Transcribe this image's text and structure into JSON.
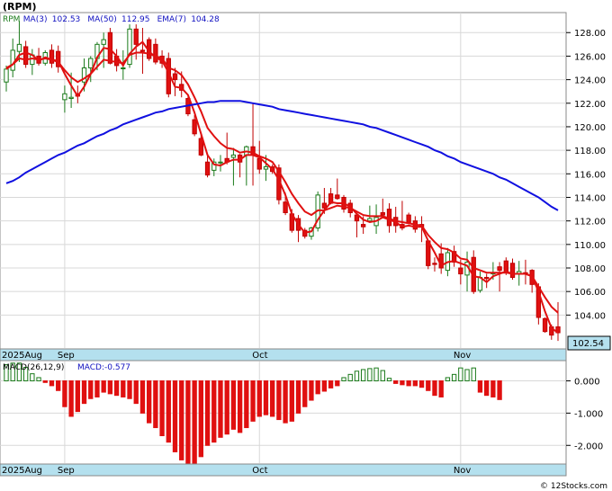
{
  "chart_data": [
    {
      "type": "candlestick",
      "title": "(RPM)",
      "legend": [
        {
          "label": "RPM",
          "color": "#000000"
        },
        {
          "label": "MA(3)",
          "value": "102.53",
          "color": "#e01010"
        },
        {
          "label": "MA(50)",
          "value": "112.95",
          "color": "#1010e0"
        },
        {
          "label": "EMA(7)",
          "value": "104.28",
          "color": "#e01010"
        }
      ],
      "ylim": [
        101.2,
        129.7
      ],
      "yticks": [
        104,
        106,
        108,
        110,
        112,
        114,
        116,
        118,
        120,
        122,
        124,
        126,
        128
      ],
      "ytick_labels": [
        "104.00",
        "106.00",
        "108.00",
        "110.00",
        "112.00",
        "114.00",
        "116.00",
        "118.00",
        "120.00",
        "122.00",
        "124.00",
        "126.00",
        "128.00"
      ],
      "last_price": "102.54",
      "x_labels": [
        {
          "label": "2025Aug",
          "index": 0
        },
        {
          "label": "Sep",
          "index": 9
        },
        {
          "label": "Oct",
          "index": 39
        },
        {
          "label": "Nov",
          "index": 70
        }
      ],
      "candles": [
        [
          123.8,
          125.2,
          123.0,
          124.9
        ],
        [
          124.8,
          127.5,
          124.2,
          126.5
        ],
        [
          126.4,
          129.0,
          125.5,
          127.0
        ],
        [
          126.8,
          127.3,
          125.0,
          125.3
        ],
        [
          125.3,
          126.6,
          124.4,
          126.1
        ],
        [
          126.0,
          126.7,
          125.2,
          125.4
        ],
        [
          125.4,
          126.5,
          125.2,
          126.3
        ],
        [
          126.5,
          127.0,
          125.0,
          125.4
        ],
        [
          126.4,
          126.9,
          124.6,
          125.1
        ],
        [
          122.3,
          123.5,
          121.2,
          122.8
        ],
        [
          122.4,
          124.6,
          121.6,
          122.5
        ],
        [
          122.8,
          123.5,
          122.0,
          122.6
        ],
        [
          123.8,
          125.8,
          123.0,
          125.0
        ],
        [
          125.0,
          126.0,
          123.8,
          125.8
        ],
        [
          125.8,
          127.2,
          124.8,
          127.0
        ],
        [
          127.0,
          128.0,
          125.0,
          127.4
        ],
        [
          128.0,
          128.4,
          125.3,
          125.4
        ],
        [
          126.0,
          126.6,
          124.7,
          125.2
        ],
        [
          125.0,
          126.5,
          124.0,
          125.0
        ],
        [
          125.3,
          128.7,
          125.0,
          128.3
        ],
        [
          128.3,
          128.7,
          125.7,
          127.0
        ],
        [
          126.5,
          128.4,
          124.5,
          126.4
        ],
        [
          127.4,
          127.6,
          125.6,
          125.8
        ],
        [
          127.0,
          127.5,
          125.3,
          125.5
        ],
        [
          126.0,
          126.5,
          125.0,
          125.4
        ],
        [
          125.8,
          126.3,
          122.5,
          122.8
        ],
        [
          124.5,
          125.0,
          122.6,
          124.0
        ],
        [
          123.6,
          124.7,
          122.5,
          123.1
        ],
        [
          122.4,
          122.6,
          120.9,
          121.1
        ],
        [
          120.6,
          121.0,
          119.2,
          119.4
        ],
        [
          119.0,
          119.3,
          117.5,
          117.6
        ],
        [
          117.0,
          117.6,
          115.7,
          115.9
        ],
        [
          116.3,
          117.3,
          115.8,
          117.0
        ],
        [
          117.0,
          117.6,
          116.2,
          117.0
        ],
        [
          117.3,
          119.5,
          116.8,
          117.0
        ],
        [
          117.4,
          118.2,
          115.0,
          117.6
        ],
        [
          117.6,
          117.7,
          115.7,
          117.0
        ],
        [
          117.6,
          118.4,
          115.0,
          118.3
        ],
        [
          118.3,
          122.0,
          115.0,
          117.6
        ],
        [
          117.3,
          118.8,
          116.0,
          116.4
        ],
        [
          116.4,
          117.6,
          115.4,
          116.6
        ],
        [
          116.6,
          116.8,
          116.0,
          116.2
        ],
        [
          116.5,
          116.8,
          113.4,
          113.8
        ],
        [
          113.6,
          114.4,
          112.5,
          112.7
        ],
        [
          112.6,
          113.0,
          111.0,
          111.2
        ],
        [
          112.2,
          112.5,
          110.2,
          111.2
        ],
        [
          111.2,
          111.4,
          110.5,
          110.7
        ],
        [
          110.7,
          111.5,
          110.4,
          111.4
        ],
        [
          111.4,
          114.5,
          111.1,
          114.2
        ],
        [
          113.5,
          114.8,
          112.6,
          113.1
        ],
        [
          114.3,
          114.8,
          113.4,
          113.5
        ],
        [
          114.2,
          115.6,
          113.8,
          113.9
        ],
        [
          114.0,
          114.2,
          112.7,
          113.0
        ],
        [
          113.5,
          113.8,
          112.3,
          112.7
        ],
        [
          112.5,
          112.6,
          110.6,
          112.0
        ],
        [
          111.7,
          112.4,
          110.9,
          111.5
        ],
        [
          112.0,
          113.3,
          111.9,
          112.2
        ],
        [
          111.6,
          113.4,
          110.9,
          112.3
        ],
        [
          112.7,
          113.9,
          112.3,
          112.5
        ],
        [
          113.0,
          113.5,
          111.0,
          111.6
        ],
        [
          112.3,
          113.2,
          111.0,
          111.6
        ],
        [
          111.7,
          113.7,
          111.2,
          111.4
        ],
        [
          112.5,
          112.7,
          111.7,
          111.8
        ],
        [
          112.0,
          112.4,
          111.0,
          111.3
        ],
        [
          111.7,
          112.4,
          110.2,
          111.5
        ],
        [
          110.3,
          110.3,
          107.9,
          108.2
        ],
        [
          108.4,
          108.9,
          107.7,
          108.3
        ],
        [
          109.2,
          110.1,
          107.5,
          108.0
        ],
        [
          107.8,
          109.7,
          107.3,
          109.3
        ],
        [
          109.4,
          109.9,
          108.1,
          108.5
        ],
        [
          108.0,
          108.7,
          106.6,
          107.5
        ],
        [
          107.4,
          109.4,
          106.0,
          108.5
        ],
        [
          108.9,
          109.5,
          105.8,
          106.0
        ],
        [
          106.1,
          107.7,
          105.9,
          107.2
        ],
        [
          107.2,
          107.5,
          106.3,
          107.1
        ],
        [
          107.5,
          108.5,
          107.0,
          107.6
        ],
        [
          108.1,
          108.5,
          106.0,
          107.8
        ],
        [
          108.6,
          108.9,
          107.4,
          107.6
        ],
        [
          108.4,
          108.8,
          107.0,
          107.2
        ],
        [
          107.5,
          108.6,
          106.5,
          107.7
        ],
        [
          107.6,
          108.7,
          106.6,
          107.5
        ],
        [
          107.8,
          107.9,
          105.9,
          106.6
        ],
        [
          106.4,
          106.7,
          103.2,
          103.8
        ],
        [
          103.7,
          103.8,
          102.5,
          102.6
        ],
        [
          103.0,
          103.2,
          101.9,
          102.3
        ],
        [
          103.0,
          105.1,
          101.8,
          102.5
        ]
      ],
      "series": [
        {
          "name": "MA(3)",
          "color": "#e01010",
          "values": [
            125.0,
            125.3,
            126.1,
            126.3,
            126.1,
            125.6,
            125.9,
            125.7,
            125.6,
            124.5,
            123.5,
            122.6,
            123.4,
            124.5,
            125.9,
            126.7,
            126.6,
            126.0,
            125.2,
            126.2,
            126.8,
            127.2,
            126.4,
            125.9,
            125.6,
            124.6,
            123.4,
            123.3,
            122.7,
            121.2,
            119.4,
            117.6,
            116.8,
            116.7,
            117.0,
            117.2,
            117.2,
            117.6,
            117.6,
            117.4,
            116.9,
            116.4,
            115.5,
            114.2,
            112.6,
            111.7,
            111.0,
            111.1,
            112.1,
            112.9,
            113.6,
            113.5,
            113.5,
            113.2,
            112.6,
            112.1,
            111.9,
            112.0,
            112.3,
            112.1,
            111.9,
            111.5,
            111.6,
            111.5,
            111.5,
            110.3,
            109.3,
            108.2,
            108.5,
            108.6,
            108.4,
            108.2,
            107.3,
            107.2,
            106.8,
            107.3,
            107.5,
            107.7,
            107.5,
            107.5,
            107.5,
            107.3,
            106.0,
            104.3,
            102.9,
            102.5
          ]
        },
        {
          "name": "EMA(7)",
          "color": "#e01010",
          "values": [
            124.9,
            125.3,
            125.8,
            125.7,
            125.8,
            125.7,
            125.8,
            125.7,
            125.5,
            124.8,
            124.2,
            123.8,
            124.1,
            124.5,
            125.1,
            125.7,
            125.6,
            125.5,
            125.4,
            126.1,
            126.3,
            126.3,
            126.2,
            126.0,
            125.8,
            125.0,
            124.8,
            124.4,
            123.6,
            122.5,
            121.3,
            119.9,
            119.2,
            118.6,
            118.2,
            118.1,
            117.8,
            117.9,
            117.8,
            117.5,
            117.3,
            117.0,
            116.2,
            115.3,
            114.3,
            113.5,
            112.8,
            112.5,
            112.9,
            112.9,
            113.1,
            113.3,
            113.2,
            113.1,
            112.8,
            112.5,
            112.4,
            112.4,
            112.4,
            112.2,
            112.0,
            111.9,
            111.8,
            111.7,
            111.6,
            110.8,
            110.2,
            109.7,
            109.6,
            109.3,
            108.8,
            108.7,
            108.0,
            107.8,
            107.6,
            107.6,
            107.6,
            107.6,
            107.5,
            107.5,
            107.5,
            107.3,
            106.4,
            105.5,
            104.7,
            104.2
          ]
        },
        {
          "name": "MA(50)",
          "color": "#1010e0",
          "values": [
            115.2,
            115.4,
            115.7,
            116.1,
            116.4,
            116.7,
            117.0,
            117.3,
            117.6,
            117.8,
            118.1,
            118.4,
            118.6,
            118.9,
            119.2,
            119.4,
            119.7,
            119.9,
            120.2,
            120.4,
            120.6,
            120.8,
            121.0,
            121.2,
            121.3,
            121.5,
            121.6,
            121.7,
            121.8,
            121.9,
            122.0,
            122.1,
            122.1,
            122.2,
            122.2,
            122.2,
            122.2,
            122.1,
            122.0,
            121.9,
            121.8,
            121.7,
            121.5,
            121.4,
            121.3,
            121.2,
            121.1,
            121.0,
            120.9,
            120.8,
            120.7,
            120.6,
            120.5,
            120.4,
            120.3,
            120.2,
            120.0,
            119.9,
            119.7,
            119.5,
            119.3,
            119.1,
            118.9,
            118.7,
            118.5,
            118.3,
            118.0,
            117.8,
            117.5,
            117.3,
            117.0,
            116.8,
            116.6,
            116.4,
            116.2,
            116.0,
            115.7,
            115.5,
            115.2,
            114.9,
            114.6,
            114.3,
            114.0,
            113.6,
            113.2,
            112.9
          ]
        }
      ]
    },
    {
      "type": "bar",
      "title": "MACD(26,12,9)",
      "legend": [
        {
          "label": "MACD(26,12,9)",
          "color": "#000000"
        },
        {
          "label": "MACD:-0.577",
          "color": "#1010e0"
        }
      ],
      "ylim": [
        -2.55,
        0.6
      ],
      "yticks": [
        0,
        -1,
        -2
      ],
      "ytick_labels": [
        "0.000",
        "-1.000",
        "-2.000"
      ],
      "x_labels": [
        {
          "label": "2025Aug",
          "index": 0
        },
        {
          "label": "Sep",
          "index": 9
        },
        {
          "label": "Oct",
          "index": 39
        },
        {
          "label": "Nov",
          "index": 70
        }
      ],
      "values": [
        0.5,
        0.55,
        0.55,
        0.42,
        0.22,
        0.1,
        -0.05,
        -0.15,
        -0.3,
        -0.8,
        -1.1,
        -0.95,
        -0.7,
        -0.55,
        -0.5,
        -0.35,
        -0.4,
        -0.45,
        -0.5,
        -0.55,
        -0.7,
        -1.0,
        -1.3,
        -1.45,
        -1.7,
        -1.9,
        -2.2,
        -2.45,
        -2.6,
        -2.6,
        -2.35,
        -2.0,
        -1.9,
        -1.75,
        -1.65,
        -1.5,
        -1.6,
        -1.45,
        -1.25,
        -1.1,
        -1.05,
        -1.1,
        -1.2,
        -1.3,
        -1.25,
        -1.0,
        -0.8,
        -0.6,
        -0.4,
        -0.32,
        -0.22,
        -0.15,
        0.1,
        0.2,
        0.3,
        0.35,
        0.38,
        0.4,
        0.32,
        0.08,
        -0.08,
        -0.12,
        -0.15,
        -0.15,
        -0.2,
        -0.3,
        -0.45,
        -0.5,
        0.1,
        0.2,
        0.4,
        0.35,
        0.4,
        -0.35,
        -0.45,
        -0.5,
        -0.58
      ],
      "colors_by_sign": {
        "positive": "#1a7a1a",
        "negative": "#e01010"
      },
      "watermark": "© 12Stocks.com"
    }
  ]
}
